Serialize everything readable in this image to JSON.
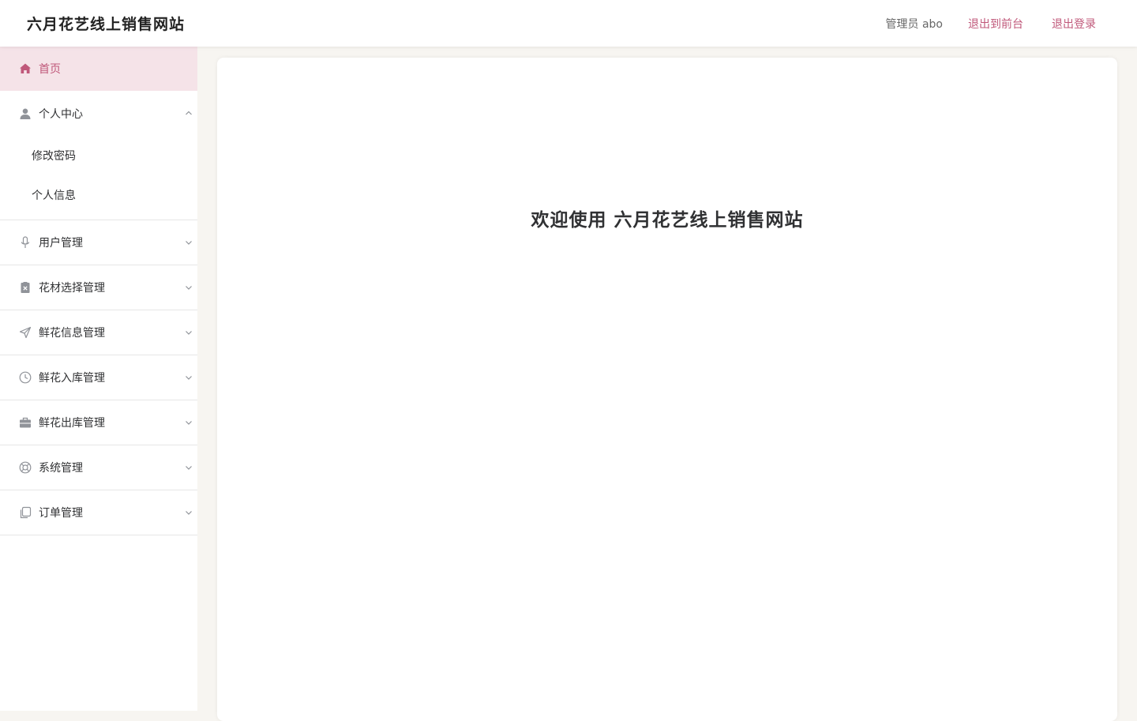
{
  "header": {
    "title": "六月花艺线上销售网站",
    "admin_label": "管理员 abo",
    "front_link": "退出到前台",
    "logout_link": "退出登录"
  },
  "sidebar": {
    "items": [
      {
        "label": "首页",
        "icon": "home-icon"
      },
      {
        "label": "个人中心",
        "icon": "user-icon",
        "children": [
          "修改密码",
          "个人信息"
        ]
      },
      {
        "label": "用户管理",
        "icon": "microphone-icon"
      },
      {
        "label": "花材选择管理",
        "icon": "clipboard-x-icon"
      },
      {
        "label": "鲜花信息管理",
        "icon": "send-icon"
      },
      {
        "label": "鲜花入库管理",
        "icon": "clock-icon"
      },
      {
        "label": "鲜花出库管理",
        "icon": "briefcase-icon"
      },
      {
        "label": "系统管理",
        "icon": "lifebuoy-icon"
      },
      {
        "label": "订单管理",
        "icon": "copy-icon"
      }
    ]
  },
  "main": {
    "welcome": "欢迎使用 六月花艺线上销售网站"
  },
  "colors": {
    "accent": "#c0587a",
    "active_bg": "#f5e3e8",
    "page_bg": "#f7f5f1"
  }
}
